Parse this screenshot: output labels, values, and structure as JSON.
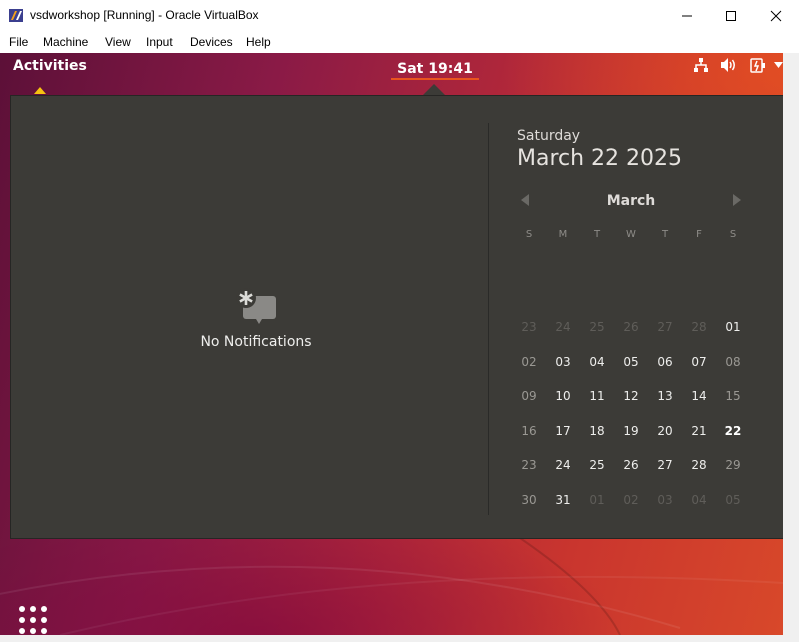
{
  "window": {
    "title": "vsdworkshop [Running] - Oracle VirtualBox",
    "app_icon": "virtualbox-icon",
    "controls": [
      "minimize-icon",
      "maximize-icon",
      "close-icon"
    ]
  },
  "menubar": {
    "items": [
      "File",
      "Machine",
      "View",
      "Input",
      "Devices",
      "Help"
    ]
  },
  "gnome": {
    "activities_label": "Activities",
    "clock": "Sat 19:41",
    "tray_icons": [
      "network-icon",
      "volume-icon",
      "power-icon",
      "chevron-down-icon"
    ]
  },
  "notifications": {
    "empty_label": "No Notifications",
    "icon": "no-notifications-icon"
  },
  "calendar": {
    "day_name": "Saturday",
    "full_date": "March 22 2025",
    "month": "March",
    "weekday_headers": [
      "S",
      "M",
      "T",
      "W",
      "T",
      "F",
      "S"
    ],
    "weeks": [
      [
        {
          "d": "23",
          "t": "other"
        },
        {
          "d": "24",
          "t": "other"
        },
        {
          "d": "25",
          "t": "other"
        },
        {
          "d": "26",
          "t": "other"
        },
        {
          "d": "27",
          "t": "other"
        },
        {
          "d": "28",
          "t": "other"
        },
        {
          "d": "01",
          "t": "weekday"
        }
      ],
      [
        {
          "d": "02",
          "t": "weekend"
        },
        {
          "d": "03",
          "t": "weekday"
        },
        {
          "d": "04",
          "t": "weekday"
        },
        {
          "d": "05",
          "t": "weekday"
        },
        {
          "d": "06",
          "t": "weekday"
        },
        {
          "d": "07",
          "t": "weekday"
        },
        {
          "d": "08",
          "t": "weekend"
        }
      ],
      [
        {
          "d": "09",
          "t": "weekend"
        },
        {
          "d": "10",
          "t": "weekday"
        },
        {
          "d": "11",
          "t": "weekday"
        },
        {
          "d": "12",
          "t": "weekday"
        },
        {
          "d": "13",
          "t": "weekday"
        },
        {
          "d": "14",
          "t": "weekday"
        },
        {
          "d": "15",
          "t": "weekend"
        }
      ],
      [
        {
          "d": "16",
          "t": "weekend"
        },
        {
          "d": "17",
          "t": "weekday"
        },
        {
          "d": "18",
          "t": "weekday"
        },
        {
          "d": "19",
          "t": "weekday"
        },
        {
          "d": "20",
          "t": "weekday"
        },
        {
          "d": "21",
          "t": "weekday"
        },
        {
          "d": "22",
          "t": "today"
        }
      ],
      [
        {
          "d": "23",
          "t": "weekend"
        },
        {
          "d": "24",
          "t": "weekday"
        },
        {
          "d": "25",
          "t": "weekday"
        },
        {
          "d": "26",
          "t": "weekday"
        },
        {
          "d": "27",
          "t": "weekday"
        },
        {
          "d": "28",
          "t": "weekday"
        },
        {
          "d": "29",
          "t": "weekend"
        }
      ],
      [
        {
          "d": "30",
          "t": "weekend"
        },
        {
          "d": "31",
          "t": "weekday"
        },
        {
          "d": "01",
          "t": "other"
        },
        {
          "d": "02",
          "t": "other"
        },
        {
          "d": "03",
          "t": "other"
        },
        {
          "d": "04",
          "t": "other"
        },
        {
          "d": "05",
          "t": "other"
        }
      ]
    ],
    "accent_color": "#e0431c"
  },
  "dock": {
    "show_apps_icon": "show-applications-icon"
  }
}
